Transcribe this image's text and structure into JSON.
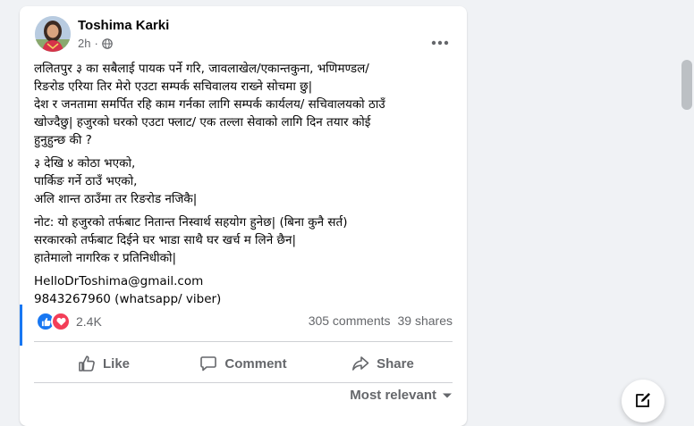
{
  "post": {
    "author": "Toshima Karki",
    "time": "2h",
    "dot": "·",
    "paragraphs": [
      "ललितपुर ३ का सबैलाई पायक पर्ने गरि, जावलाखेल/एकान्तकुना, भणिमण्डल/\nरिङरोड एरिया तिर मेरो एउटा सम्पर्क सचिवालय राख्ने सोचमा छु|\nदेश र जनतामा समर्पित रहि काम गर्नका लागि सम्पर्क कार्यलय/ सचिवालयको ठाउँ\nखोज्दैछु| हजुरको घरको एउटा फ्लाट/ एक तल्ला सेवाको लागि दिन तयार कोई\nहुनुहुन्छ की ?",
      "३ देखि ४ कोठा भएको,\nपार्किङ गर्ने ठाउँ भएको,\nअलि शान्त ठाउँमा तर रिङरोड नजिकै|",
      "नोट: यो हजुरको तर्फबाट नितान्त निस्वार्थ सहयोग हुनेछ| (बिना कुनै सर्त)\nसरकारको तर्फबाट दिईने घर भाडा साथै घर खर्च म लिने छैन|\nहातेमालो नागरिक र प्रतिनिधीको|"
    ],
    "email": "HelloDrToshima@gmail.com",
    "phone": "9843267960 (whatsapp/ viber)",
    "reactions_count": "2.4K",
    "comments_count": "305 comments",
    "shares_count": "39 shares"
  },
  "actions": {
    "like": "Like",
    "comment": "Comment",
    "share": "Share"
  },
  "sort_label": "Most relevant",
  "icons": {
    "privacy": "globe-icon",
    "more": "more-options-icon",
    "like_reaction": "like-reaction-icon",
    "love_reaction": "love-reaction-icon",
    "like": "thumbs-up-icon",
    "comment": "comment-bubble-icon",
    "share": "share-arrow-icon",
    "sort": "caret-down-icon",
    "compose": "compose-icon"
  },
  "colors": {
    "like_blue": "#1877f2",
    "love_red": "#f33e58",
    "secondary_text": "#65676b",
    "background": "#f0f2f5"
  }
}
